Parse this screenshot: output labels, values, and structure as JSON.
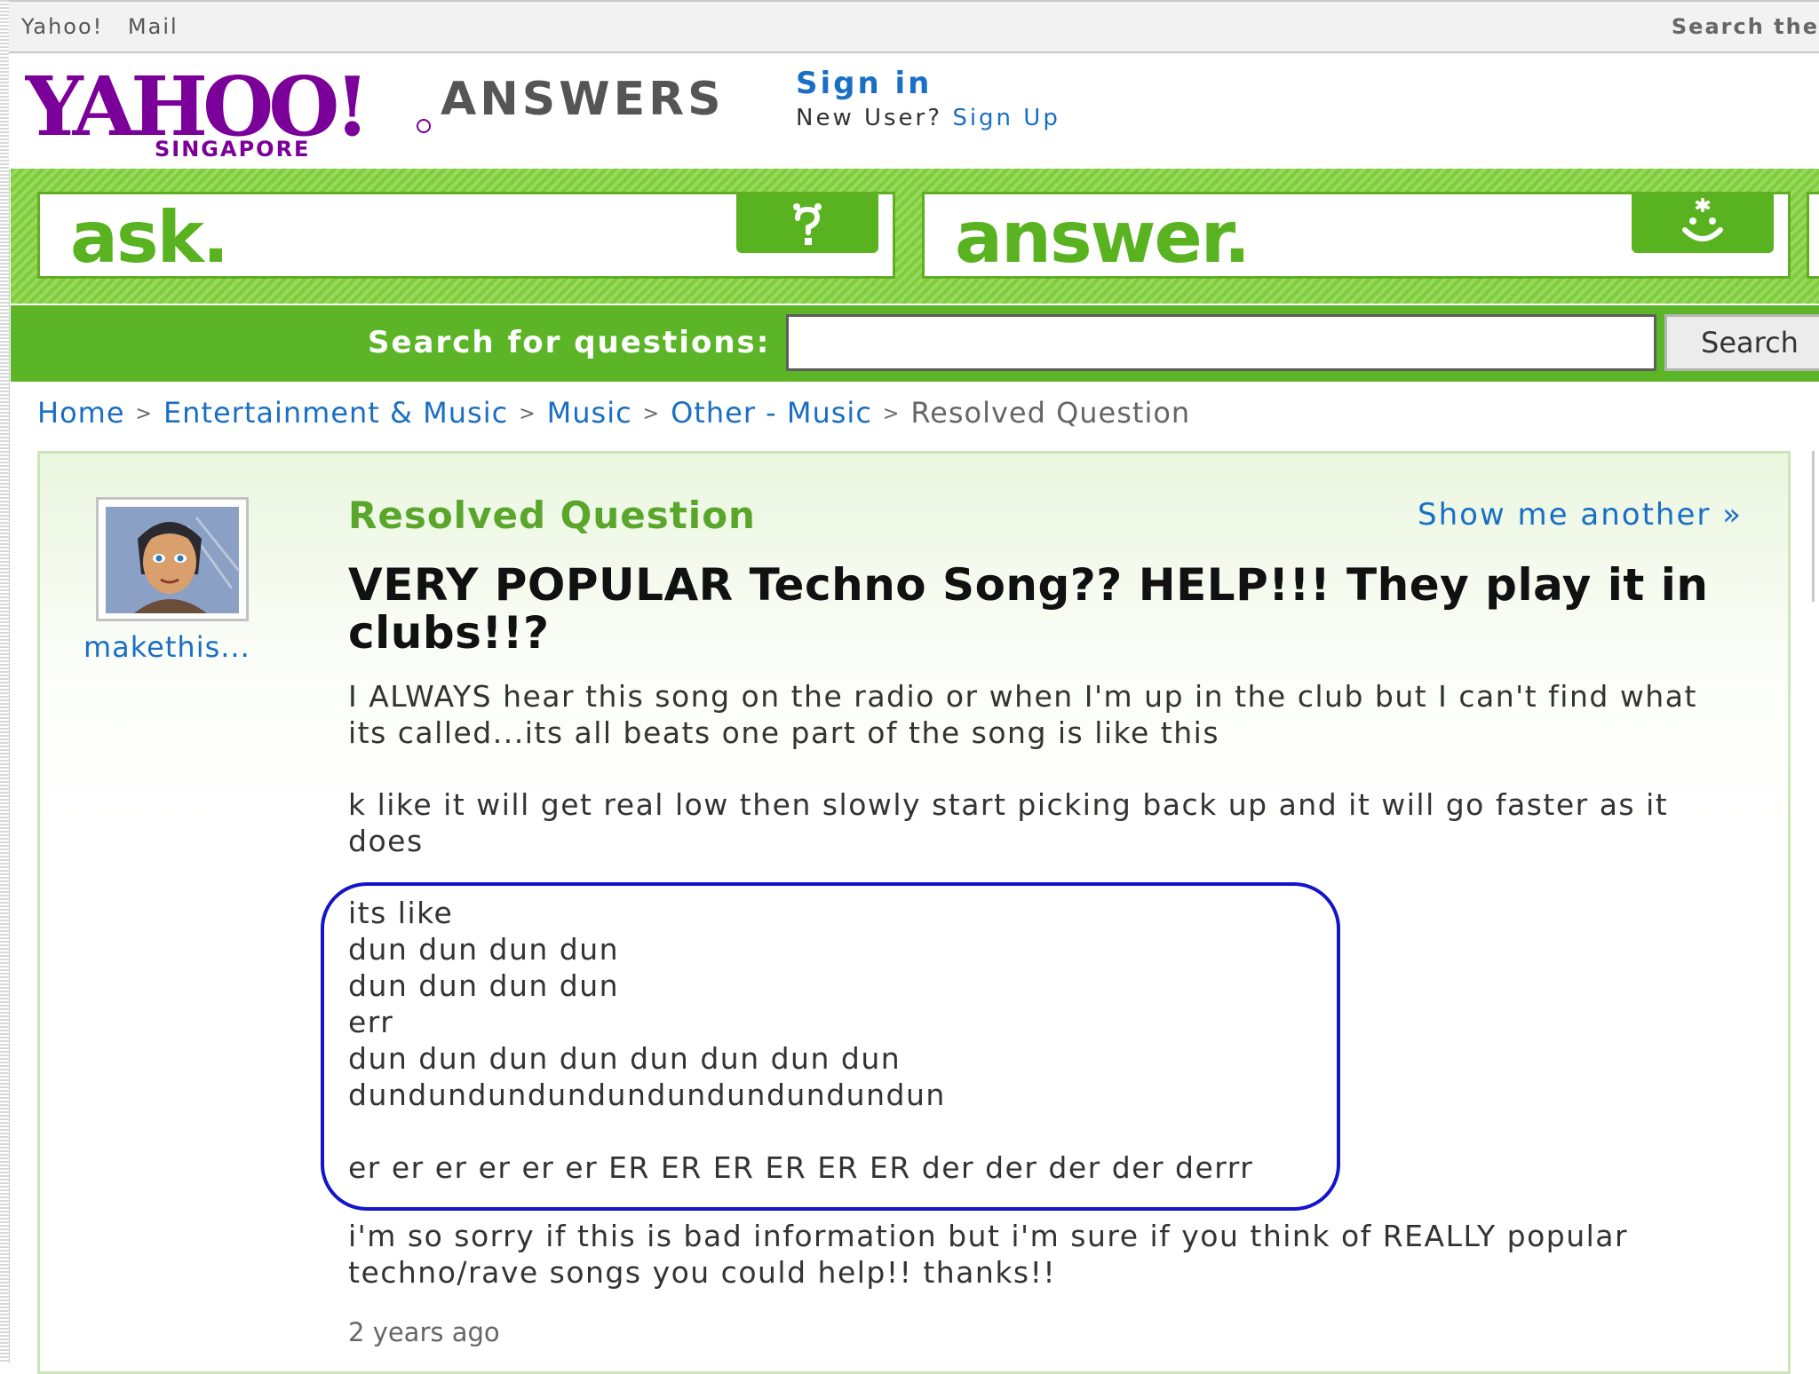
{
  "topbar": {
    "yahoo": "Yahoo!",
    "mail": "Mail",
    "search_web": "Search the"
  },
  "header": {
    "logo_text": "YAHOO!",
    "logo_region": "SINGAPORE",
    "answers": "ANSWERS",
    "sign_in": "Sign in",
    "new_user": "New User?",
    "sign_up": "Sign Up"
  },
  "actions": {
    "ask": "ask.",
    "answer": "answer."
  },
  "search": {
    "label": "Search for questions:",
    "value": "",
    "button": "Search"
  },
  "breadcrumb": [
    "Home",
    "Entertainment & Music",
    "Music",
    "Other - Music",
    "Resolved Question"
  ],
  "question": {
    "status": "Resolved Question",
    "show_another": "Show me another »",
    "username": "makethis...",
    "title": "VERY POPULAR Techno Song?? HELP!!! They play it in clubs!!?",
    "p1": "I ALWAYS hear this song on the radio or when I'm up in the club but I can't find what its called...its all beats one part of the song is like this",
    "p2": "k like it will get real low then slowly start picking back up and it will go faster as it does",
    "p3": "its like\ndun dun dun dun\ndun dun dun dun\nerr\ndun dun dun dun dun dun dun dun\ndundundundundundundundundundun\n\ner er er er er er ER ER ER ER ER ER der der der der derrr",
    "p4": "i'm so sorry if this is bad information but i'm sure if you think of REALLY popular techno/rave songs you could help!! thanks!!",
    "time_ago": "2 years ago"
  },
  "colors": {
    "green": "#5cb526",
    "link": "#1a6fc4",
    "logo_purple": "#7b0099",
    "highlight": "#1414c8"
  }
}
